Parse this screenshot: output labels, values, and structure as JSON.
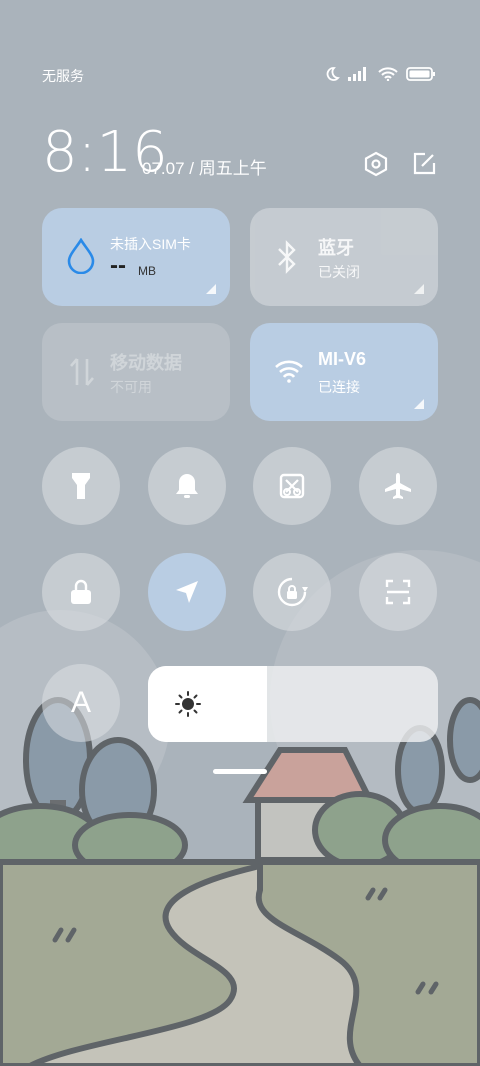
{
  "status_bar": {
    "carrier": "无服务",
    "icons": [
      "moon-icon",
      "signal-icon",
      "wifi-icon",
      "battery-icon"
    ]
  },
  "header": {
    "time": "8:16",
    "date": "07.07 / 周五上午",
    "icons": [
      "settings-icon",
      "edit-icon"
    ]
  },
  "tiles": {
    "data": {
      "title": "未插入SIM卡",
      "value": "-- ",
      "unit": "MB",
      "icon": "drop-icon"
    },
    "bluetooth": {
      "title": "蓝牙",
      "sub": "已关闭",
      "icon": "bluetooth-icon"
    },
    "mobile": {
      "title": "移动数据",
      "sub": "不可用",
      "icon": "data-arrows-icon"
    },
    "wifi": {
      "title": "MI-V6",
      "sub": "已连接",
      "icon": "wifi-icon"
    }
  },
  "toggles_row1": [
    "flashlight-icon",
    "bell-icon",
    "screenshot-icon",
    "airplane-icon"
  ],
  "toggles_row2": [
    "lock-icon",
    "location-icon",
    "rotation-lock-icon",
    "scan-icon"
  ],
  "auto_brightness": {
    "label": "A"
  },
  "brightness": {
    "level": 0.41,
    "icon": "sun-icon"
  },
  "colors": {
    "accent_blue": "#b9cde3",
    "tile_gray": "#c9ced4",
    "water_blue": "#2a8ae8"
  }
}
